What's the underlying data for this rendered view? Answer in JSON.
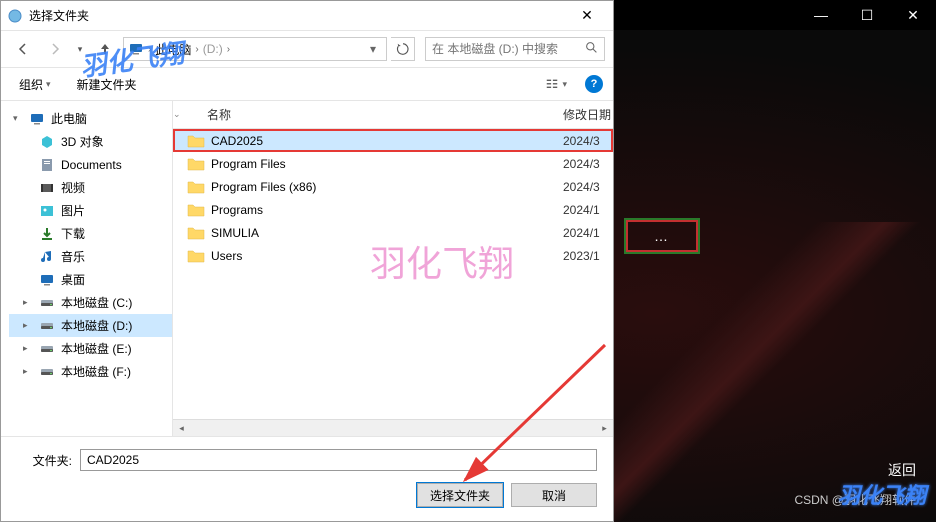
{
  "bg": {
    "minimize": "—",
    "maximize": "☐",
    "close": "✕",
    "browse": "…",
    "return": "返回",
    "credit": "CSDN @羽化飞翔软件",
    "watermark": "羽化飞翔"
  },
  "dialog": {
    "title": "选择文件夹",
    "close": "✕"
  },
  "nav": {
    "breadcrumb_pc": "此电脑",
    "drive_label": "(D:)",
    "search_placeholder": "在 本地磁盘 (D:) 中搜索"
  },
  "toolbar": {
    "organize": "组织",
    "newfolder": "新建文件夹",
    "help": "?"
  },
  "columns": {
    "name": "名称",
    "date": "修改日期"
  },
  "sidebar": {
    "root": "此电脑",
    "items": [
      {
        "label": "3D 对象",
        "icon": "3d"
      },
      {
        "label": "Documents",
        "icon": "doc"
      },
      {
        "label": "视频",
        "icon": "video"
      },
      {
        "label": "图片",
        "icon": "pic"
      },
      {
        "label": "下载",
        "icon": "dl"
      },
      {
        "label": "音乐",
        "icon": "music"
      },
      {
        "label": "桌面",
        "icon": "desk"
      },
      {
        "label": "本地磁盘 (C:)",
        "icon": "disk"
      },
      {
        "label": "本地磁盘 (D:)",
        "icon": "disk",
        "selected": true
      },
      {
        "label": "本地磁盘 (E:)",
        "icon": "disk"
      },
      {
        "label": "本地磁盘 (F:)",
        "icon": "disk"
      }
    ]
  },
  "rows": [
    {
      "name": "CAD2025",
      "date": "2024/3",
      "selected": true
    },
    {
      "name": "Program Files",
      "date": "2024/3"
    },
    {
      "name": "Program Files (x86)",
      "date": "2024/3"
    },
    {
      "name": "Programs",
      "date": "2024/1"
    },
    {
      "name": "SIMULIA",
      "date": "2024/1"
    },
    {
      "name": "Users",
      "date": "2023/1"
    }
  ],
  "footer": {
    "label": "文件夹:",
    "value": "CAD2025",
    "select": "选择文件夹",
    "cancel": "取消"
  },
  "wm": {
    "tl": "羽化飞翔",
    "mid": "羽化飞翔"
  }
}
